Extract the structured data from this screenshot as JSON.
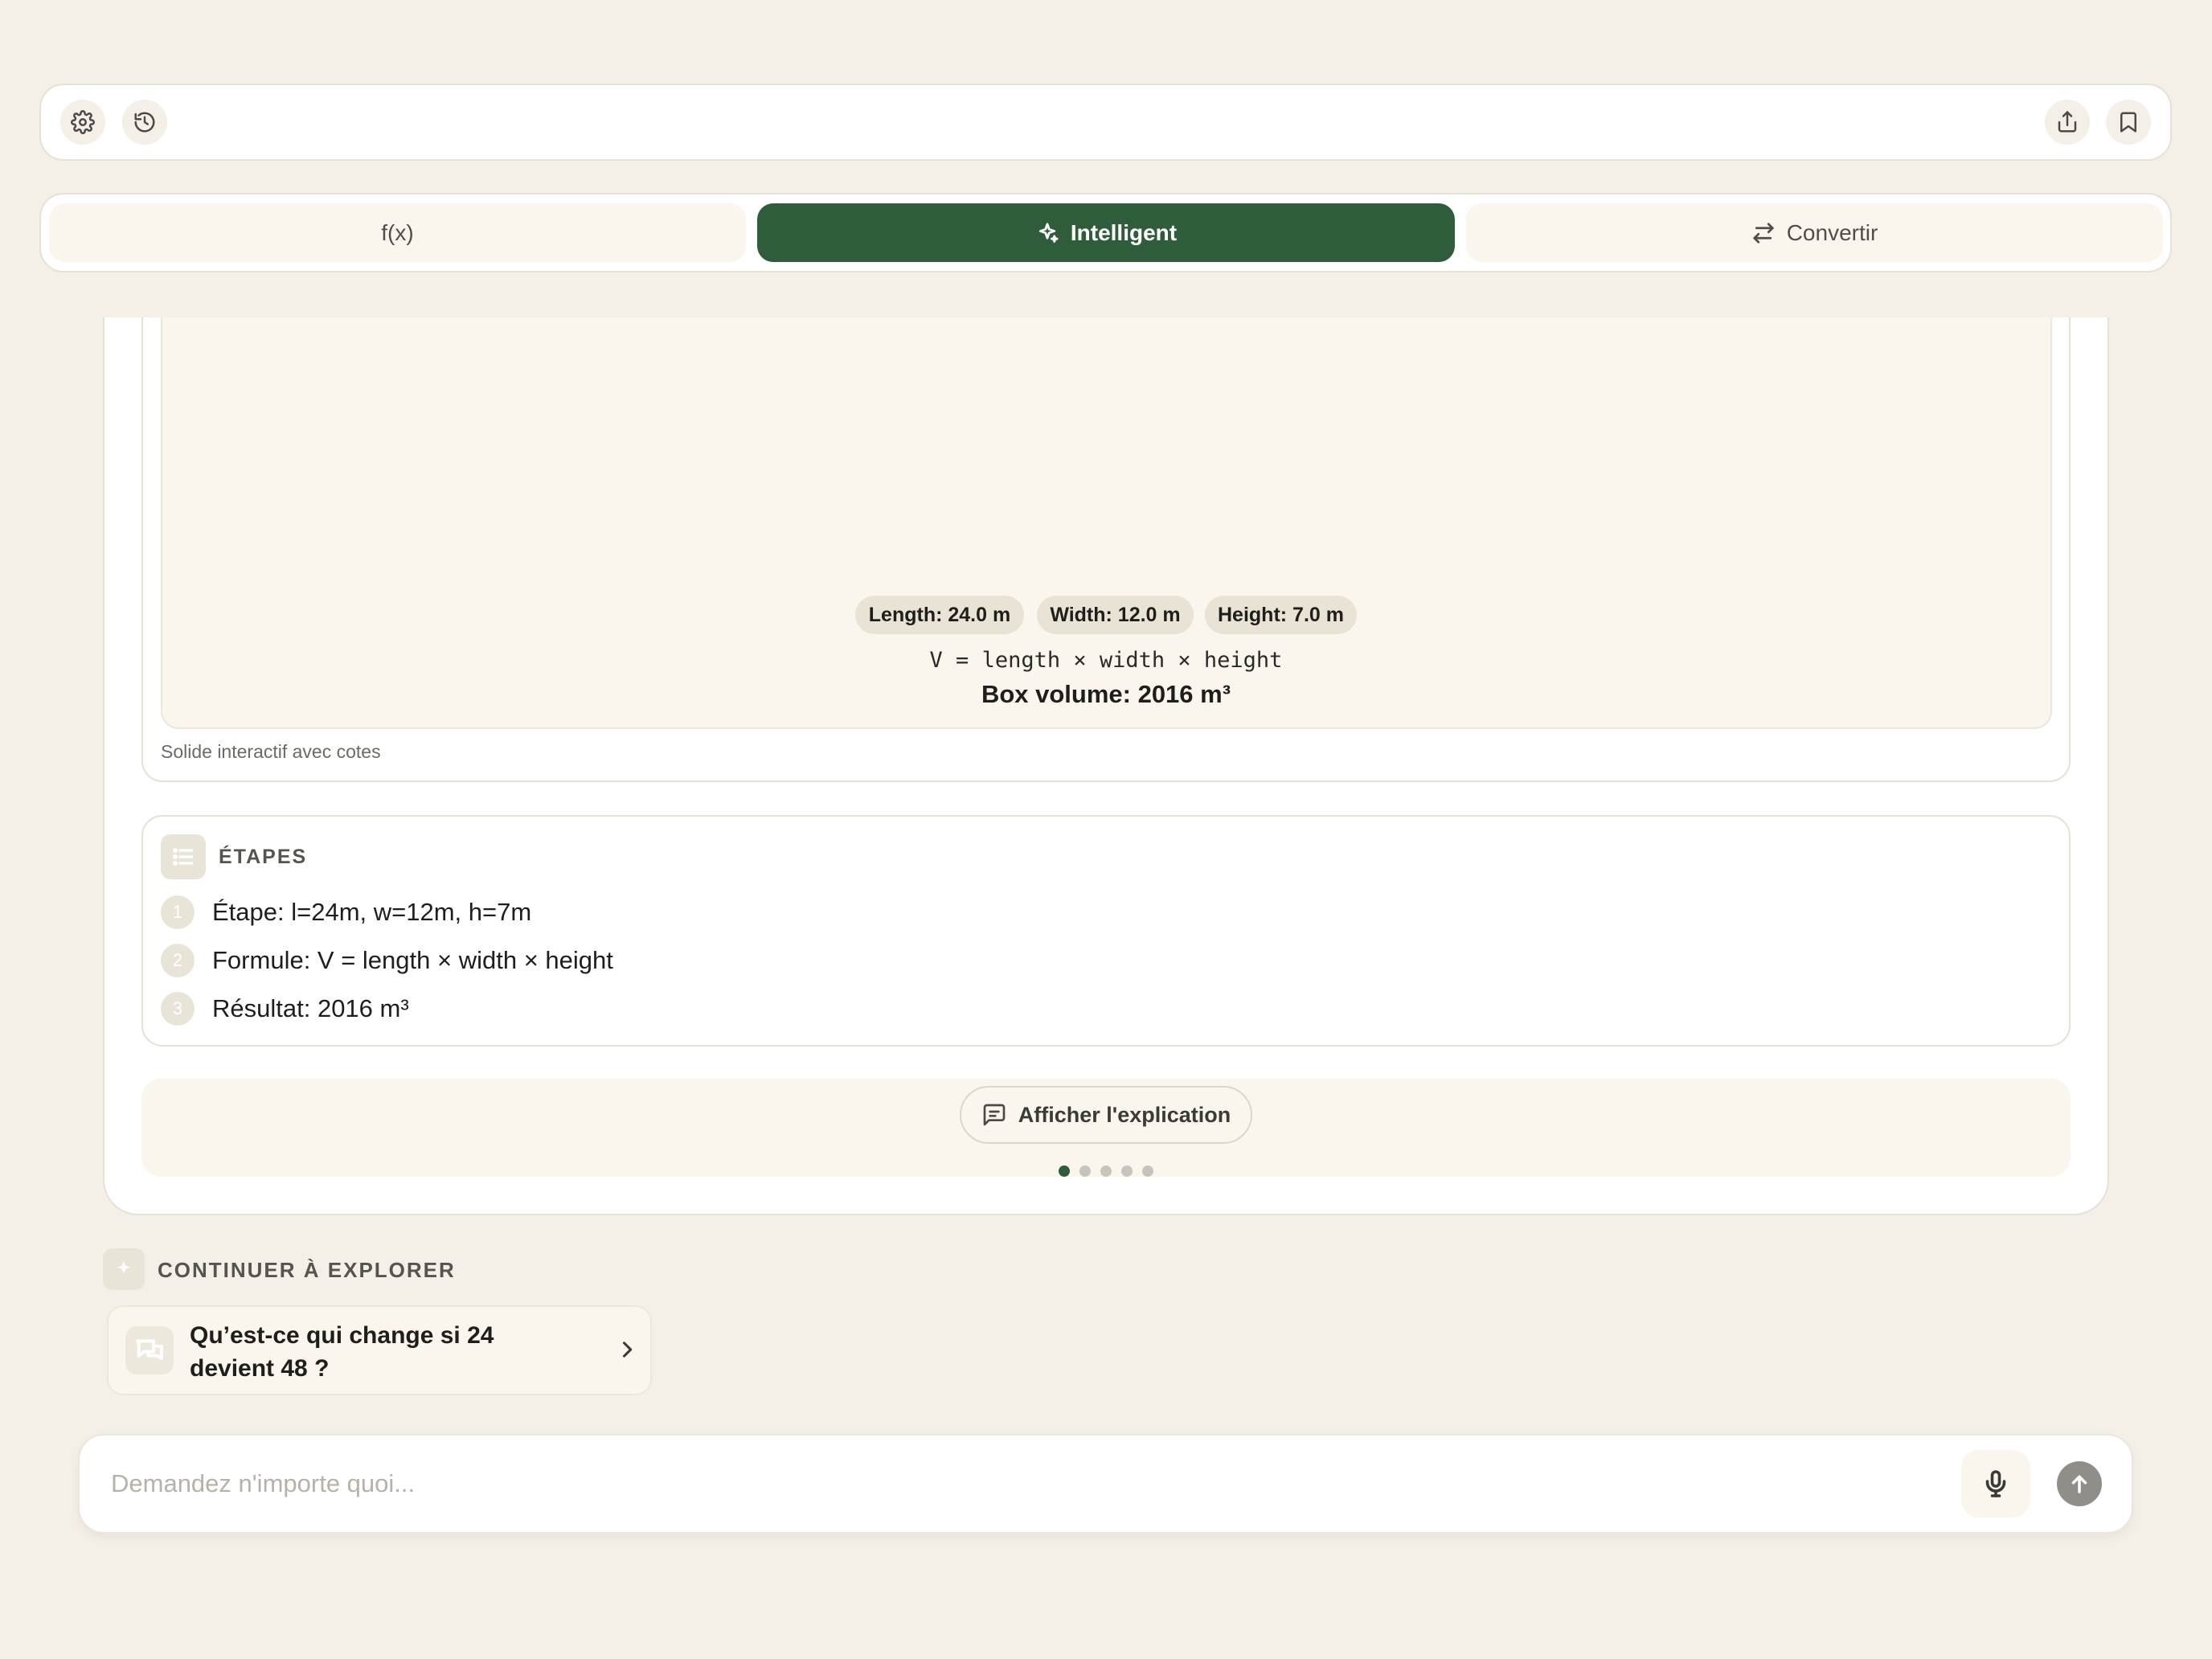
{
  "toolbar": {
    "left_icons": [
      "gear-icon",
      "history-icon"
    ],
    "right_icons": [
      "share-icon",
      "bookmark-icon"
    ]
  },
  "tabs": [
    {
      "label": "f(x)",
      "icon": "",
      "active": false
    },
    {
      "label": "Intelligent",
      "icon": "sparkle-icon",
      "active": true
    },
    {
      "label": "Convertir",
      "icon": "convert-arrows-icon",
      "active": false
    }
  ],
  "accent_color": "#2f5d3c",
  "visualization": {
    "dimensions": {
      "length": "Length: 24.0 m",
      "width": "Width: 12.0 m",
      "height": "Height: 7.0 m"
    },
    "formula": "V = length × width × height",
    "result": "Box volume: 2016 m³",
    "caption": "Solide interactif avec cotes"
  },
  "steps": {
    "title": "ÉTAPES",
    "items": [
      {
        "num": "1",
        "text": "Étape: l=24m, w=12m, h=7m"
      },
      {
        "num": "2",
        "text": "Formule: V = length × width × height"
      },
      {
        "num": "3",
        "text": "Résultat: 2016 m³"
      }
    ]
  },
  "explanation": {
    "button_label": "Afficher l'explication",
    "page_count": 5,
    "current_page": 1
  },
  "explore": {
    "title": "CONTINUER À EXPLORER",
    "suggestion": "Qu’est-ce qui change si 24 devient 48 ?"
  },
  "input": {
    "placeholder": "Demandez n'importe quoi...",
    "value": ""
  }
}
